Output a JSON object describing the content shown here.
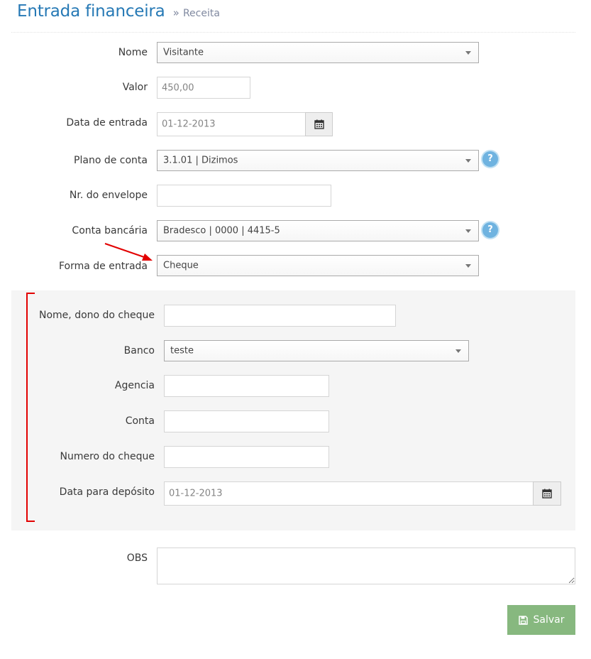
{
  "header": {
    "title": "Entrada financeira",
    "separator": "»",
    "subtitle": "Receita"
  },
  "form": {
    "nome": {
      "label": "Nome",
      "value": "Visitante"
    },
    "valor": {
      "label": "Valor",
      "value": "450,00"
    },
    "data_entrada": {
      "label": "Data de entrada",
      "value": "01-12-2013"
    },
    "plano_conta": {
      "label": "Plano de conta",
      "value": "3.1.01 | Dizimos",
      "help": "?"
    },
    "nr_envelope": {
      "label": "Nr. do envelope",
      "value": ""
    },
    "conta_bancaria": {
      "label": "Conta bancária",
      "value": "Bradesco | 0000 | 4415-5",
      "help": "?"
    },
    "forma_entrada": {
      "label": "Forma de entrada",
      "value": "Cheque"
    }
  },
  "cheque": {
    "dono": {
      "label": "Nome, dono do cheque",
      "value": ""
    },
    "banco": {
      "label": "Banco",
      "value": "teste"
    },
    "agencia": {
      "label": "Agencia",
      "value": ""
    },
    "conta": {
      "label": "Conta",
      "value": ""
    },
    "numero": {
      "label": "Numero do cheque",
      "value": ""
    },
    "data_deposito": {
      "label": "Data para depósito",
      "value": "01-12-2013"
    }
  },
  "obs": {
    "label": "OBS",
    "value": ""
  },
  "actions": {
    "save_label": "Salvar"
  },
  "colors": {
    "title": "#2679b5",
    "annotation": "#e20000",
    "save_button": "#87b87f",
    "help": "#6fb3e0"
  }
}
